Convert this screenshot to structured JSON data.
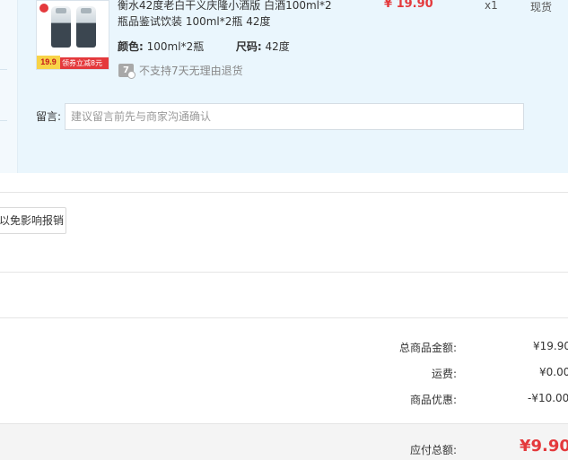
{
  "item": {
    "title": "衡水42度老白干义庆隆小酒版 白酒100ml*2瓶品鉴试饮装 100ml*2瓶 42度",
    "color_label": "颜色:",
    "color_value": "100ml*2瓶",
    "size_label": "尺码:",
    "size_value": "42度",
    "policy_icon": "7",
    "policy_text": "不支持7天无理由退货",
    "price": "¥ 19.90",
    "quantity": "x1",
    "stock": "现货",
    "thumbnail": {
      "price_tag": "19.9",
      "promo_text": "领券立减8元",
      "icon": "product-thumbnail-image"
    }
  },
  "note": {
    "label": "留言:",
    "placeholder": "建议留言前先与商家沟通确认"
  },
  "invoice": {
    "button_label": "以免影响报销"
  },
  "summary": {
    "rows": [
      {
        "label": "总商品金额:",
        "value": "¥19.90"
      },
      {
        "label": "运费:",
        "value": "¥0.00"
      },
      {
        "label": "商品优惠:",
        "value": "-¥10.00"
      }
    ],
    "total_label": "应付总额:",
    "total_value": "¥9.90"
  },
  "colors": {
    "accent_red": "#e4393c",
    "panel_bg": "#eaf6fd",
    "total_bar_bg": "#f4f4f4"
  }
}
